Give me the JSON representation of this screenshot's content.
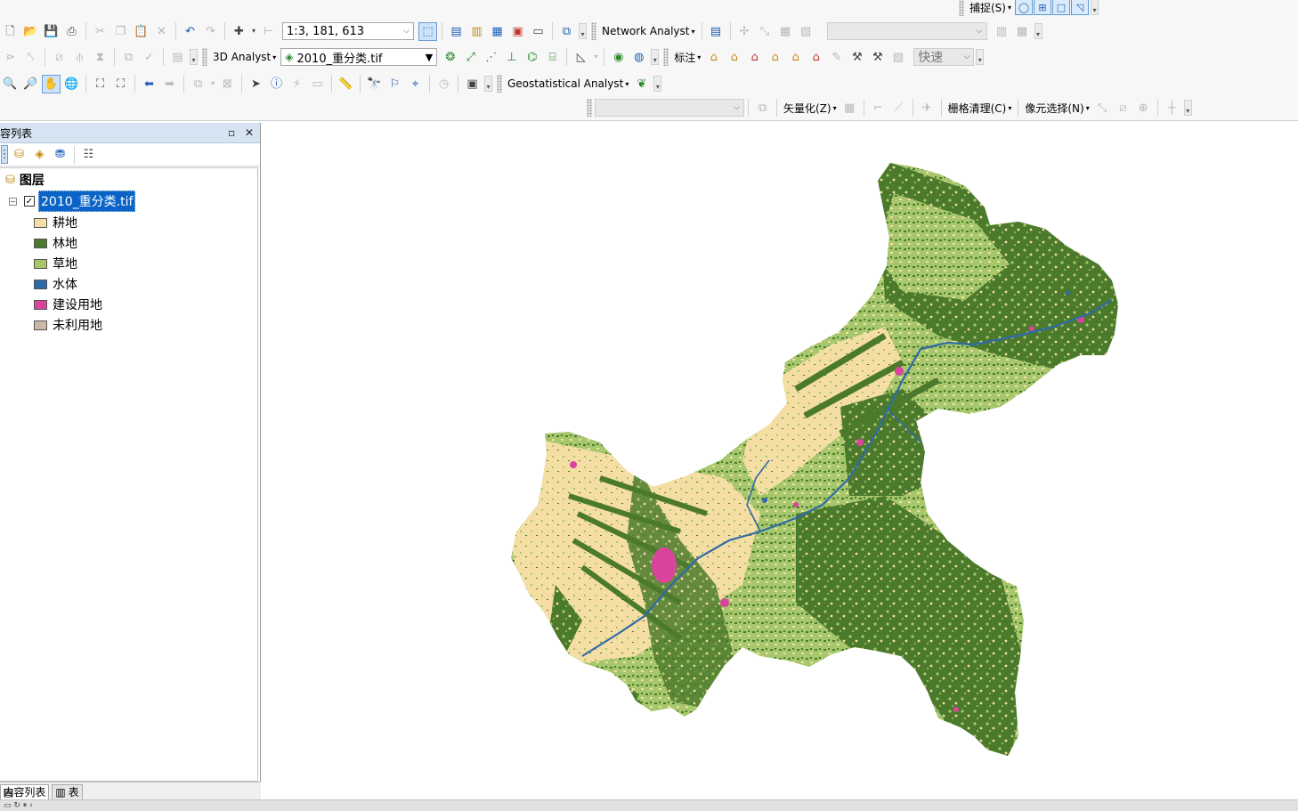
{
  "toolbar": {
    "snap_menu": "捕捉(S)",
    "scale_value": "1:3, 181, 613",
    "network_analyst": "Network Analyst",
    "analyst_3d": "3D Analyst",
    "layer_combo": "2010_重分类.tif",
    "labeling_menu": "标注",
    "speed_combo": "快速",
    "geostatistical": "Geostatistical Analyst",
    "vectorize_menu": "矢量化(Z)",
    "raster_cleanup_menu": "栅格清理(C)",
    "cell_select_menu": "像元选择(N)"
  },
  "toc": {
    "title": "内容列表",
    "root_label": "图层",
    "layer_name": "2010_重分类.tif",
    "layer_checked": "✓",
    "legend": [
      {
        "label": "耕地",
        "color": "#f5dea3"
      },
      {
        "label": "林地",
        "color": "#4c7a2c"
      },
      {
        "label": "草地",
        "color": "#a6c76c"
      },
      {
        "label": "水体",
        "color": "#2f6aa8"
      },
      {
        "label": "建设用地",
        "color": "#d9459d"
      },
      {
        "label": "未利用地",
        "color": "#c9b9a6"
      }
    ],
    "tabs": {
      "contents": "内容列表",
      "table": "表"
    }
  },
  "icons": {
    "new": "new-document-icon",
    "open": "open-folder-icon",
    "save": "save-icon",
    "print": "print-icon",
    "cut": "cut-icon",
    "copy": "copy-icon",
    "paste": "paste-icon",
    "delete": "delete-icon",
    "undo": "undo-icon",
    "redo": "redo-icon",
    "add_data": "add-data-icon",
    "zoom_in": "zoom-in-icon",
    "zoom_out": "zoom-out-icon",
    "pan": "pan-hand-icon",
    "full_extent": "globe-icon",
    "back": "back-arrow-icon",
    "forward": "forward-arrow-icon",
    "select": "select-arrow-icon",
    "identify": "identify-icon",
    "find": "binoculars-icon"
  }
}
